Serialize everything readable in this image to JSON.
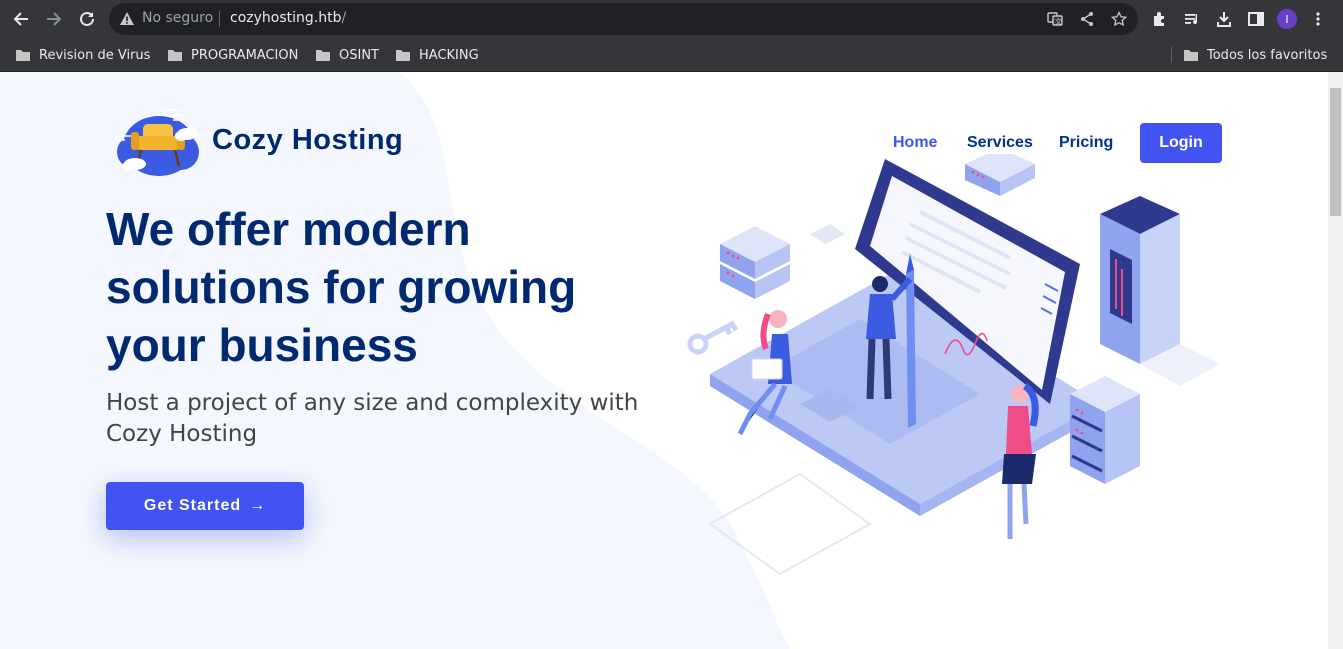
{
  "browser": {
    "security_label": "No seguro",
    "url_host": "cozyhosting.htb",
    "url_path": "/",
    "profile_initial": "I",
    "bookmarks": [
      {
        "label": "Revision de Virus"
      },
      {
        "label": "PROGRAMACION"
      },
      {
        "label": "OSINT"
      },
      {
        "label": "HACKING"
      }
    ],
    "all_bookmarks_label": "Todos los favoritos"
  },
  "site": {
    "brand": "Cozy Hosting",
    "nav": {
      "home": "Home",
      "services": "Services",
      "pricing": "Pricing",
      "login": "Login"
    },
    "hero": {
      "title_line1": "We offer modern",
      "title_line2": "solutions for growing",
      "title_line3": "your business",
      "subtitle": "Host a project of any size and complexity with Cozy Hosting",
      "cta_label": "Get Started",
      "cta_arrow": "→"
    }
  },
  "colors": {
    "primary": "#4154f1",
    "navy": "#012970",
    "text": "#444444",
    "page_bg": "#f4f7fd",
    "chrome_bg": "#35363a"
  }
}
